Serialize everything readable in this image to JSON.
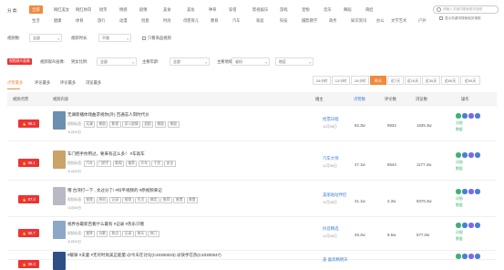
{
  "categories": {
    "label": "分  类:",
    "row1": [
      "全部",
      "网红美女",
      "网红帅哥",
      "搞笑",
      "情感",
      "剧情",
      "美食",
      "美妆",
      "种草",
      "穿搭",
      "影视娱乐",
      "游戏",
      "宠物",
      "音乐",
      "舞蹈",
      "萌娃"
    ],
    "row2": [
      "生活",
      "健康",
      "体育",
      "旅行",
      "动漫",
      "创意",
      "时尚",
      "母婴育儿",
      "教育",
      "汽车",
      "家居",
      "科技",
      "摄影教学",
      "政务",
      "知识资讯",
      "办公",
      "文学艺术",
      "户外"
    ],
    "active": "全部"
  },
  "search": {
    "placeholder": "请输入关键词搜索相关视频"
  },
  "checkbox_top": "显示关键词搜索相关视频",
  "filters1": [
    {
      "label": "视频数:",
      "value": "全部"
    },
    {
      "label": "视频时长:",
      "value": "不限"
    }
  ],
  "filters1_check": "只看商品视频",
  "audience": {
    "badge": "视频观众画像",
    "label": "视频观众画像:",
    "fields": [
      {
        "label": "男女比例:",
        "value": "全部"
      },
      {
        "label": "主要年龄:",
        "value": "全部"
      },
      {
        "label": "主要地域:",
        "value": "省份"
      },
      {
        "label": "",
        "value": "地区"
      }
    ]
  },
  "periods": [
    "24小时",
    "12小时",
    "24小时",
    "昨天",
    "近7天",
    "近15天",
    "近30天",
    "近60天",
    "近90天"
  ],
  "period_active": 3,
  "sort_tabs": [
    "点赞最多",
    "评论最多",
    "评论最多",
    "浏览最多"
  ],
  "sort_active": 0,
  "columns": {
    "rank": "视频点赞",
    "content": "视频内容",
    "blogger": "播主",
    "likes": "点赞数",
    "comments": "评论数",
    "shares": "浏览数",
    "ops": "操作"
  },
  "rows": [
    {
      "rank": "98.2",
      "title": "无澜新播体戏曲求视你(外)  百通志人刻时代价",
      "tags_label": "视频标签:",
      "tags": [
        "无澜",
        "美剧",
        "影视",
        "深入剧情",
        "追剧",
        "美剧",
        "美剧"
      ],
      "date": "11月06日",
      "blogger": "抢票日程",
      "bdate": "11月06日",
      "likes": "82.3w",
      "comments": "8932",
      "shares": "1635.3w",
      "thumb": "#6b8fb0"
    },
    {
      "rank": "98.1",
      "title": "车门把手你用过，要来有这么多！ #车就车",
      "tags_label": "视频标签:",
      "tags": [
        "汽车",
        "门把手",
        "影视",
        "推荐",
        "开车",
        "干货",
        "安全"
      ],
      "date": "11月06日",
      "blogger": "汽车大师",
      "bdate": "11月06日",
      "likes": "47.1w",
      "comments": "8644",
      "shares": "1177.4w",
      "thumb": "#c9a36a"
    },
    {
      "rank": "97.3",
      "title": "哦  台湾打一下 , 太过分了!  #抖平视频的 #原视频来记",
      "tags_label": "视频标签:",
      "tags": [
        "视频",
        "原创",
        "记录",
        "视频",
        "生活",
        "搞笑",
        "推荐",
        "美食",
        "美食"
      ],
      "date": "11月06日",
      "blogger": "美丽咕咕伴侣",
      "bdate": "11月06日",
      "likes": "41.1w",
      "comments": "2.3w",
      "shares": "5076.3w",
      "thumb": "#b9b9c4"
    },
    {
      "rank": "96.7",
      "title": "视界谷最新百看什么最有 #记录 #热乐只哦",
      "tags_label": "视频标签:",
      "tags": [
        "视界",
        "谷歌",
        "热点",
        "记录",
        "热乐",
        "热门"
      ],
      "date": "11月06日",
      "blogger": "抖音精选",
      "bdate": "11月06日",
      "likes": "45.2w",
      "comments": "8.5w",
      "shares": "577.0w",
      "thumb": "#8da7c7"
    },
    {
      "rank": "96.3",
      "title": "#暖锋 #夫妻 #无尽时尚美正能量 @今天在讨论(C40300033) @快手在热(C40300047)",
      "tags_label": "",
      "tags": [],
      "date": "",
      "blogger": "盖  喜欢精明天",
      "bdate": "",
      "likes": "",
      "comments": "",
      "shares": "",
      "thumb": "#2e4f86"
    }
  ],
  "row_ops": [
    "详细",
    "播放",
    "收藏",
    "分享"
  ],
  "row_links": [
    "详细",
    "数据"
  ],
  "colors": {
    "accent": "#f08a3e",
    "rank": "#e33333",
    "link": "#3a7bd5",
    "op_green": "#3cb371",
    "op_blue": "#4a7fd6",
    "op_purple": "#7b68ee"
  }
}
